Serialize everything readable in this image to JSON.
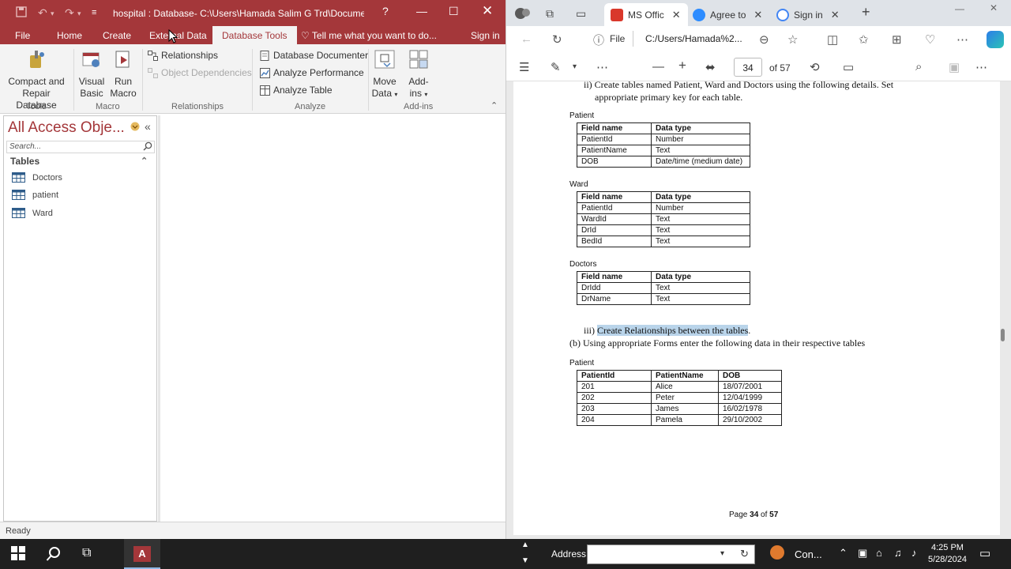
{
  "access": {
    "title": "hospital : Database- C:\\Users\\Hamada Salim G Trd\\Document...",
    "help": "?",
    "tabs": [
      "File",
      "Home",
      "Create",
      "External Data",
      "Database Tools"
    ],
    "active_tab": "Database Tools",
    "tell_me": "Tell me what you want to do...",
    "sign_in": "Sign in",
    "ribbon": {
      "compact_repair": "Compact and Repair Database",
      "visual_basic": "Visual Basic",
      "run_macro": "Run Macro",
      "relationships": "Relationships",
      "object_dependencies": "Object Dependencies",
      "database_documenter": "Database Documenter",
      "analyze_performance": "Analyze Performance",
      "analyze_table": "Analyze Table",
      "move_data": "Move Data",
      "add_ins": "Add-ins",
      "groups": [
        "Tools",
        "Macro",
        "Relationships",
        "Analyze",
        "Add-ins"
      ]
    },
    "nav": {
      "title": "All Access Obje...",
      "search_placeholder": "Search...",
      "section": "Tables",
      "items": [
        "Doctors",
        "patient",
        "Ward"
      ]
    },
    "status": "Ready"
  },
  "edge": {
    "tabs": [
      {
        "label": "MS Offic"
      },
      {
        "label": "Agree to"
      },
      {
        "label": "Sign in"
      }
    ],
    "address_prefix": "File",
    "address": "C:/Users/Hamada%2...",
    "page_current": "34",
    "page_total": "of 57"
  },
  "pdf": {
    "intro_line1": "ii) Create tables named Patient, Ward and Doctors using the following details. Set",
    "intro_line2": "appropriate primary key for each table.",
    "patient_label": "Patient",
    "patient_schema": {
      "headers": [
        "Field name",
        "Data type"
      ],
      "rows": [
        [
          "PatientId",
          "Number"
        ],
        [
          "PatientName",
          "Text"
        ],
        [
          "DOB",
          "Date/time (medium date)"
        ]
      ]
    },
    "ward_label": "Ward",
    "ward_schema": {
      "headers": [
        "Field name",
        "Data type"
      ],
      "rows": [
        [
          "PatientId",
          "Number"
        ],
        [
          "WardId",
          "Text"
        ],
        [
          "DrId",
          "Text"
        ],
        [
          "BedId",
          "Text"
        ]
      ]
    },
    "doctors_label": "Doctors",
    "doctors_schema": {
      "headers": [
        "Field name",
        "Data type"
      ],
      "rows": [
        [
          "DrIdd",
          "Text"
        ],
        [
          "DrName",
          "Text"
        ]
      ]
    },
    "step3_prefix": "iii)",
    "step3_text": "Create Relationships between the tables",
    "step3_suffix": ".",
    "step_b": "(b) Using appropriate Forms enter the following data in their respective tables",
    "patient_data_label": "Patient",
    "patient_data": {
      "headers": [
        "PatientId",
        "PatientName",
        "DOB"
      ],
      "rows": [
        [
          "201",
          "Alice",
          "18/07/2001"
        ],
        [
          "202",
          "Peter",
          "12/04/1999"
        ],
        [
          "203",
          "James",
          "16/02/1978"
        ],
        [
          "204",
          "Pamela",
          "29/10/2002"
        ]
      ]
    },
    "footer_prefix": "Page",
    "footer_page": "34",
    "footer_of": "of",
    "footer_total": "57"
  },
  "taskbar": {
    "app_label": "A",
    "address_label": "Address",
    "connect_label": "Con...",
    "time": "4:25 PM",
    "date": "5/28/2024"
  },
  "colors": {
    "access_red": "#a4373a",
    "highlight": "#b9d4ea",
    "taskbar": "#1f1f1f"
  }
}
